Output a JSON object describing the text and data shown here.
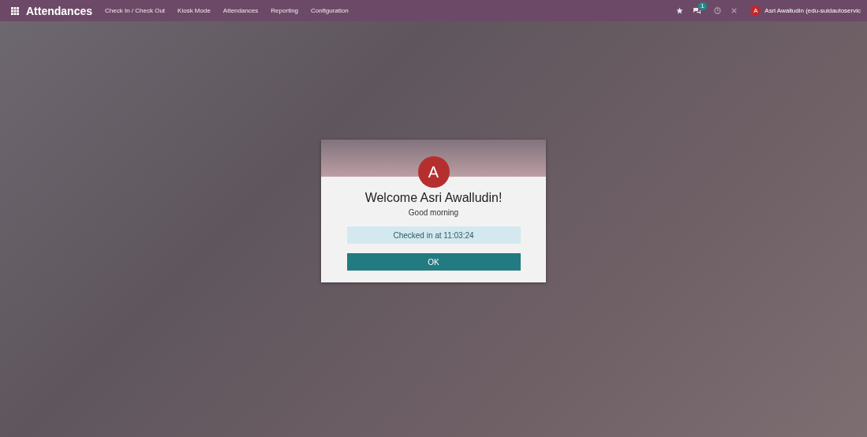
{
  "navbar": {
    "app_title": "Attendances",
    "menu": [
      "Check In / Check Out",
      "Kiosk Mode",
      "Attendances",
      "Reporting",
      "Configuration"
    ],
    "messages_badge": "1",
    "user": {
      "initial": "A",
      "name": "Asri Awalludin (edu-suidautoservic"
    }
  },
  "dialog": {
    "avatar_initial": "A",
    "title": "Welcome Asri Awalludin!",
    "greeting": "Good morning",
    "status": "Checked in at 11:03:24",
    "button": "OK"
  }
}
